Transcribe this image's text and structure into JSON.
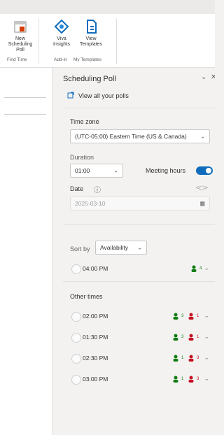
{
  "ribbon": {
    "buttons": [
      {
        "label": "New\nScheduling Poll",
        "group": "Find Time"
      },
      {
        "label": "Viva\nInsights",
        "group": "Add-in"
      },
      {
        "label": "View\nTemplates",
        "group": "My Templates"
      }
    ]
  },
  "panel": {
    "title": "Scheduling Poll",
    "view_all_link": "View all your polls",
    "timezone_label": "Time zone",
    "timezone_value": "(UTC-05:00) Eastern Time (US & Canada)",
    "duration_label": "Duration",
    "duration_value": "01:00",
    "meeting_hours_label": "Meeting hours",
    "meeting_hours_on": true,
    "date_label": "Date",
    "date_value": "2025-03-10",
    "sort_label": "Sort by",
    "sort_value": "Availability",
    "top_time": {
      "time": "04:00 PM",
      "available": "4"
    },
    "other_times_label": "Other times",
    "other_times": [
      {
        "time": "02:00 PM",
        "available": "3",
        "conflicts": "1"
      },
      {
        "time": "01:30 PM",
        "available": "3",
        "conflicts": "1"
      },
      {
        "time": "02:30 PM",
        "available": "1",
        "conflicts": "3"
      },
      {
        "time": "03:00 PM",
        "available": "1",
        "conflicts": "3"
      }
    ]
  },
  "colors": {
    "accent": "#0f6cbd",
    "available": "#107c10",
    "conflict": "#c50f1f"
  }
}
